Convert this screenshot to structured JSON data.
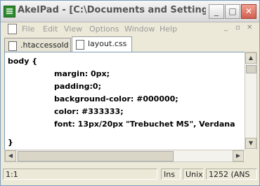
{
  "window": {
    "title": "AkelPad - [C:\\Documents and Settings\\...",
    "buttons": {
      "minimize": "_",
      "maximize": "□",
      "close": "✕"
    }
  },
  "menu": {
    "items": [
      "File",
      "Edit",
      "View",
      "Options",
      "Window",
      "Help"
    ],
    "mdi_minimize": "_",
    "mdi_restore": "▫",
    "mdi_close": "✕"
  },
  "tabs": [
    {
      "label": ".htaccessold",
      "active": false
    },
    {
      "label": "layout.css",
      "active": true
    }
  ],
  "editor": {
    "lines": [
      "body {",
      "margin: 0px;",
      "padding:0;",
      "background-color: #000000;",
      "color: #333333;",
      "font: 13px/20px \"Trebuchet MS\", Verdana",
      "",
      "}"
    ]
  },
  "status": {
    "position": "1:1",
    "insert_mode": "Ins",
    "line_ending": "Unix",
    "codepage": "1252  (ANS"
  },
  "colors": {
    "close_button": "#d06050",
    "title_text": "#555555"
  }
}
